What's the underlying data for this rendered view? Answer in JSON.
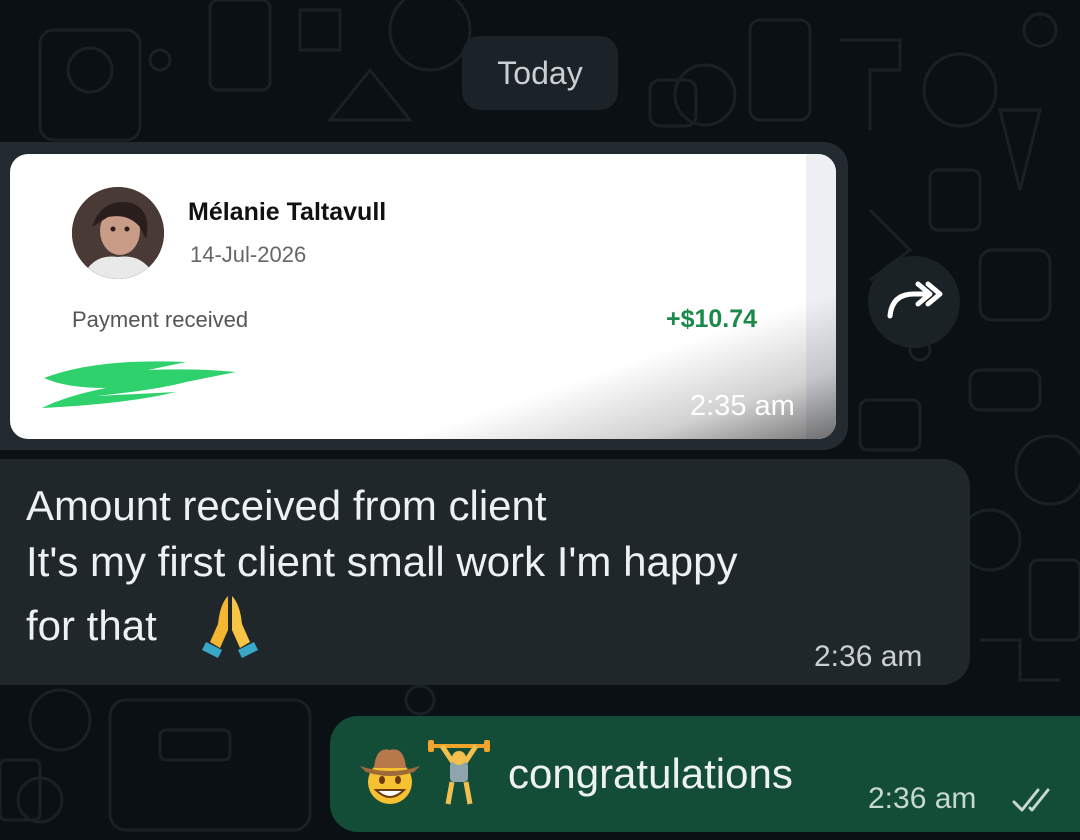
{
  "date_divider": "Today",
  "payment_card": {
    "payer_name": "Mélanie Taltavull",
    "date": "14-Jul-2026",
    "label": "Payment received",
    "amount": "+$10.74",
    "time": "2:35 am"
  },
  "incoming_text": {
    "lines": [
      "Amount received from client",
      "It's my first client small work I'm happy",
      "for that"
    ],
    "emoji": "🙏",
    "time": "2:36 am"
  },
  "outgoing": {
    "emojis": [
      "🤠",
      "🏋️"
    ],
    "text": "congratulations",
    "time": "2:36 am",
    "status": "read"
  },
  "icons": {
    "forward": "forward-icon",
    "read_receipt": "double-check-icon"
  },
  "colors": {
    "background": "#0b1014",
    "incoming_bubble": "#1f272b",
    "outgoing_bubble": "#144d37",
    "amount_green": "#1a8a4a",
    "tick_color": "#c7d9cf"
  }
}
